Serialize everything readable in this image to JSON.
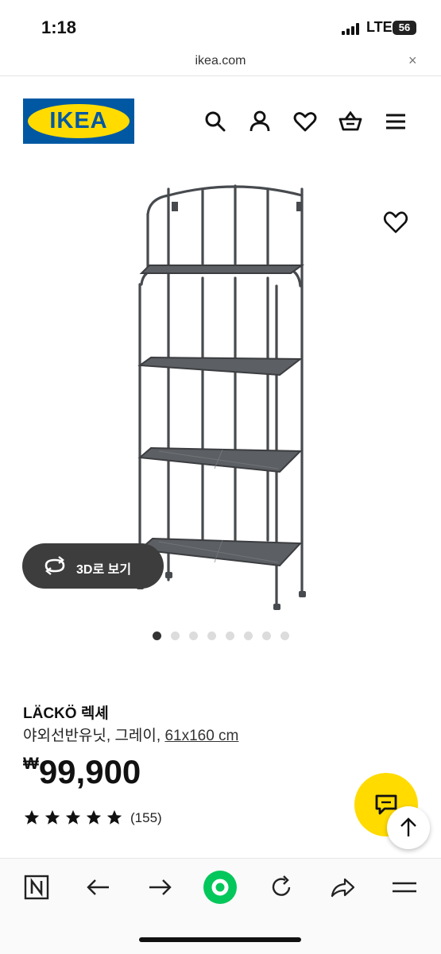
{
  "status_bar": {
    "time": "1:18",
    "network": "LTE",
    "battery": "56"
  },
  "browser": {
    "url": "ikea.com",
    "close_glyph": "×"
  },
  "header": {
    "logo_text": "IKEA",
    "icons": [
      "search-icon",
      "account-icon",
      "favorites-icon",
      "cart-icon",
      "menu-icon"
    ],
    "brand_blue": "#0058A3",
    "brand_yellow": "#FFDB00"
  },
  "gallery": {
    "view_3d_label": "3D로 보기",
    "image_count": 8,
    "active_index": 0
  },
  "product": {
    "name": "LÄCKÖ 렉셰",
    "description": "야외선반유닛, 그레이, ",
    "size": "61x160 cm",
    "currency": "₩",
    "price": "99,900",
    "rating_stars": 5,
    "review_count": "(155)"
  },
  "browser_toolbar": {
    "items": [
      "naver-icon",
      "back-arrow-icon",
      "forward-arrow-icon",
      "green-home-icon",
      "refresh-icon",
      "share-icon",
      "menu-icon"
    ],
    "green": "#03C75A"
  }
}
